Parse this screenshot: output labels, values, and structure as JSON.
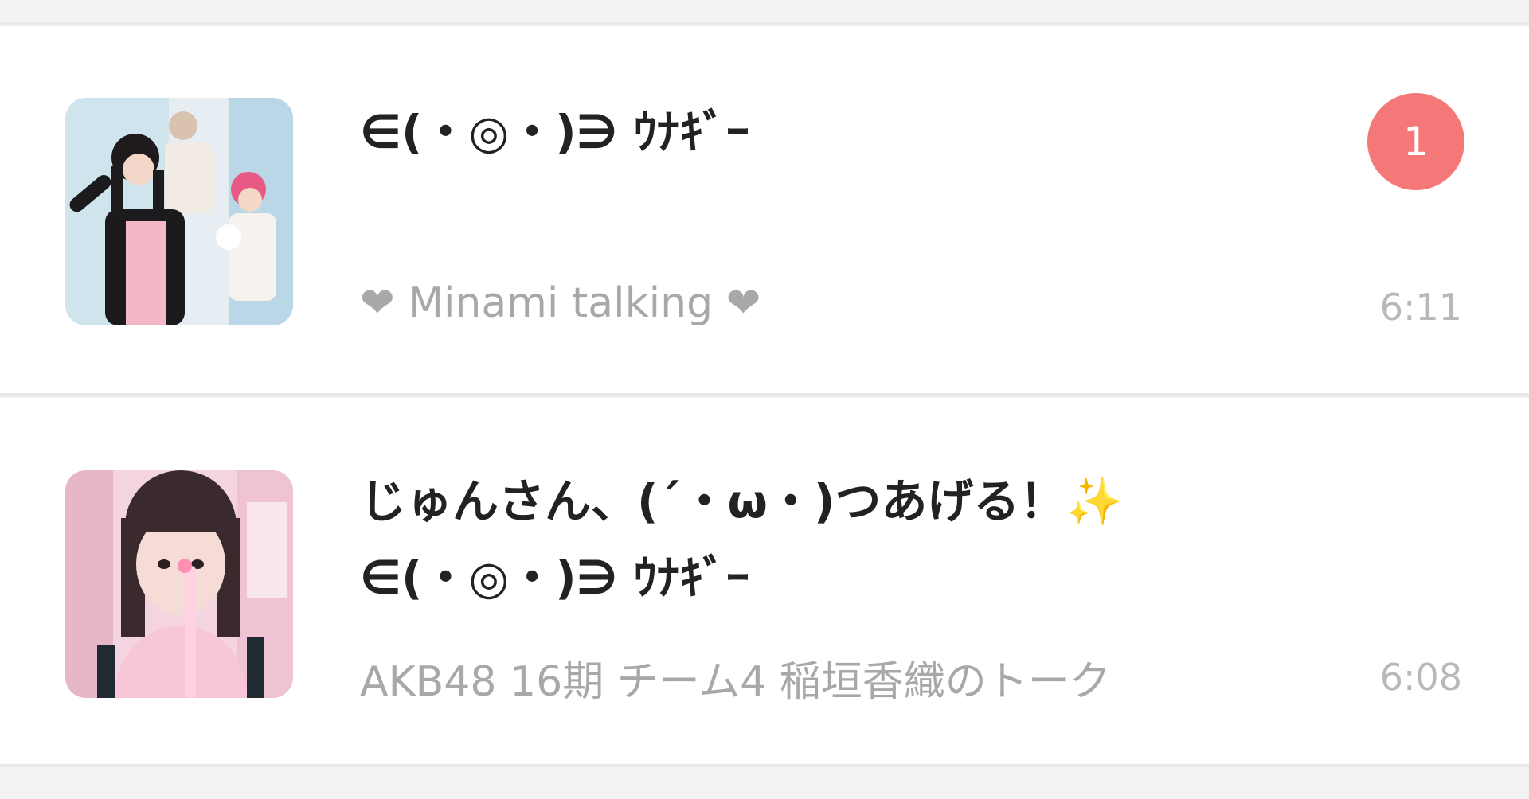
{
  "chats": [
    {
      "title_lines": [
        "∈(・◎・)∋ ｳﾅｷﾞｰ"
      ],
      "preview": "❤ Minami talking ❤",
      "time": "6:11",
      "unread": "1"
    },
    {
      "title_lines": [
        "じゅんさん、(´・ω・)つあげる！✨",
        "∈(・◎・)∋ ｳﾅｷﾞｰ"
      ],
      "preview": "AKB48 16期  チーム4  稲垣香織のトーク",
      "time": "6:08"
    }
  ],
  "colors": {
    "badge": "#f57878",
    "title": "#222222",
    "preview": "#a8a8a8",
    "time": "#b8b8b8",
    "divider": "#e9e9e9"
  }
}
